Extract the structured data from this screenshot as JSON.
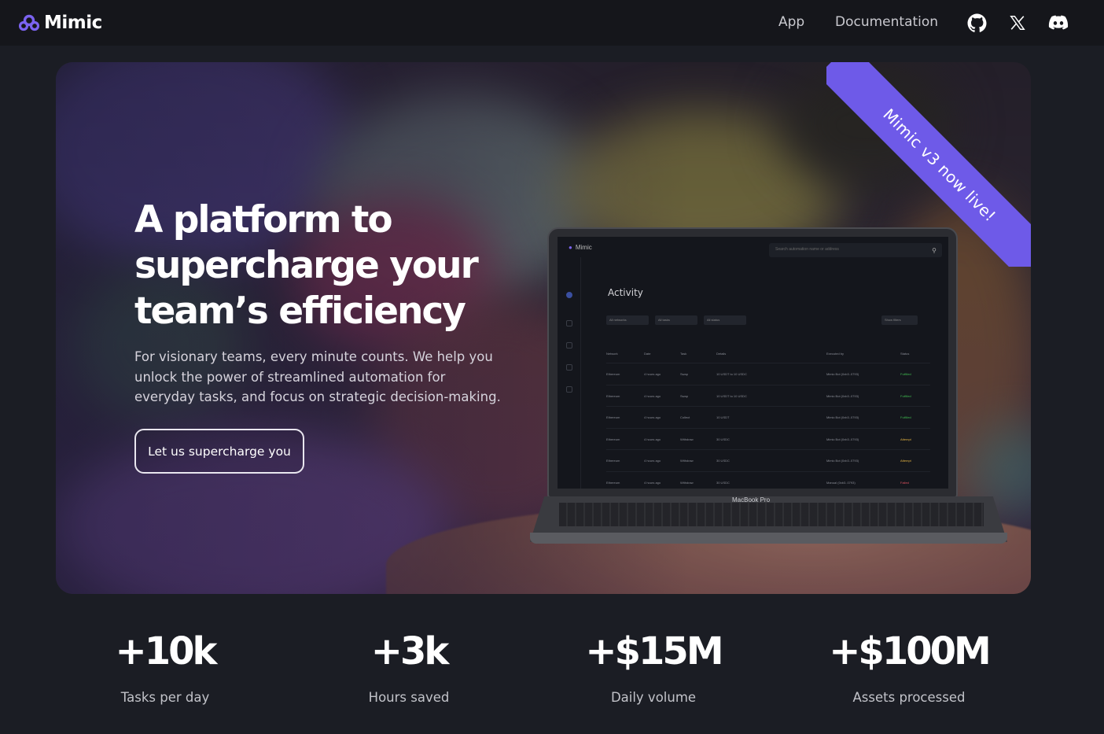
{
  "brand": {
    "name": "Mimic",
    "color": "#6e5ae8"
  },
  "nav": {
    "links": [
      {
        "label": "App"
      },
      {
        "label": "Documentation"
      }
    ],
    "icons": [
      "github-icon",
      "x-twitter-icon",
      "discord-icon"
    ]
  },
  "hero": {
    "headline_lines": [
      "A platform to",
      "supercharge your",
      "team’s efficiency"
    ],
    "subtitle": "For visionary teams, every minute counts. We help you unlock the power of streamlined automation for everyday tasks, and focus on strategic decision-making.",
    "cta_label": "Let us supercharge you",
    "ribbon": "Mimic v3 now live!"
  },
  "laptop_screen": {
    "app_name": "Mimic",
    "search_placeholder": "Search automation name or address",
    "page_title": "Activity",
    "filters": [
      "All networks",
      "All tasks",
      "All status"
    ],
    "show_filters": "Show filters",
    "columns": [
      "Network",
      "Date",
      "Task",
      "Details",
      "Executed by",
      "Status"
    ],
    "rows": [
      {
        "network": "Ethereum",
        "date": "4 hours ago",
        "task": "Swap",
        "details": "10 USDT to 10 USDC",
        "executed_by": "Mimic Bot (0xb3..0793)",
        "status": "Fulfilled",
        "status_kind": "ok"
      },
      {
        "network": "Ethereum",
        "date": "4 hours ago",
        "task": "Swap",
        "details": "10 USDT to 10 USDC",
        "executed_by": "Mimic Bot (0xb3..0793)",
        "status": "Fulfilled",
        "status_kind": "ok"
      },
      {
        "network": "Ethereum",
        "date": "4 hours ago",
        "task": "Collect",
        "details": "10 USDT",
        "executed_by": "Mimic Bot (0xb3..0793)",
        "status": "Fulfilled",
        "status_kind": "ok"
      },
      {
        "network": "Ethereum",
        "date": "4 hours ago",
        "task": "Withdraw",
        "details": "30 USDC",
        "executed_by": "Mimic Bot (0xb3..0793)",
        "status": "Attempt",
        "status_kind": "warn"
      },
      {
        "network": "Ethereum",
        "date": "4 hours ago",
        "task": "Withdraw",
        "details": "30 USDC",
        "executed_by": "Mimic Bot (0xb3..0793)",
        "status": "Attempt",
        "status_kind": "warn"
      },
      {
        "network": "Ethereum",
        "date": "4 hours ago",
        "task": "Withdraw",
        "details": "30 USDC",
        "executed_by": "Manual (0xb3..0793)",
        "status": "Failed",
        "status_kind": "bad"
      }
    ],
    "device_label": "MacBook Pro"
  },
  "stats": [
    {
      "value": "+10k",
      "label": "Tasks per day"
    },
    {
      "value": "+3k",
      "label": "Hours saved"
    },
    {
      "value": "+$15M",
      "label": "Daily volume"
    },
    {
      "value": "+$100M",
      "label": "Assets processed"
    }
  ]
}
